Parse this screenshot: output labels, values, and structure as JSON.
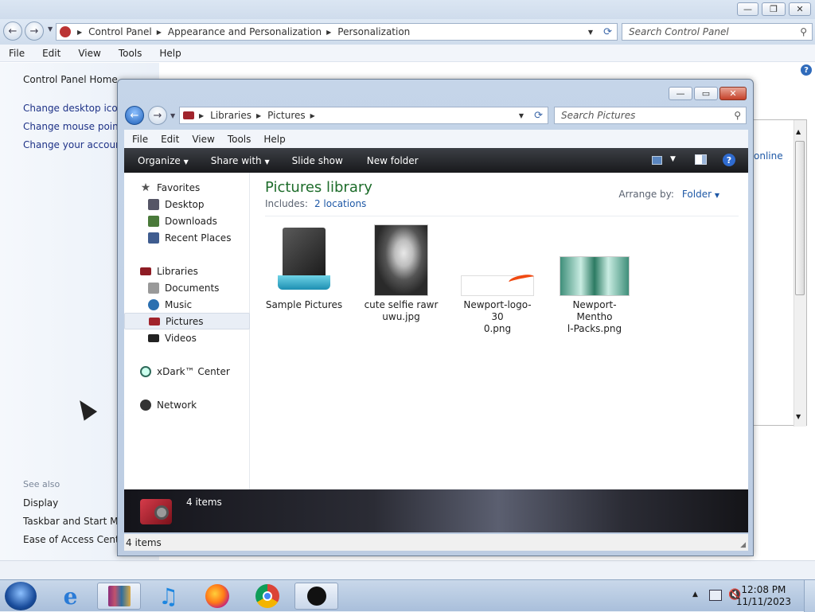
{
  "control_panel": {
    "breadcrumb": [
      "Control Panel",
      "Appearance and Personalization",
      "Personalization"
    ],
    "search_placeholder": "Search Control Panel",
    "menu": [
      "File",
      "Edit",
      "View",
      "Tools",
      "Help"
    ],
    "left_links": [
      "Control Panel Home",
      "Change desktop icons",
      "Change mouse pointe",
      "Change your account"
    ],
    "see_also_label": "See also",
    "see_also_links": [
      "Display",
      "Taskbar and Start Men",
      "Ease of Access Center"
    ],
    "partial_link": "online"
  },
  "explorer": {
    "breadcrumb": [
      "Libraries",
      "Pictures"
    ],
    "search_placeholder": "Search Pictures",
    "menu": [
      "File",
      "Edit",
      "View",
      "Tools",
      "Help"
    ],
    "toolbar": {
      "organize": "Organize",
      "share_with": "Share with",
      "slide_show": "Slide show",
      "new_folder": "New folder"
    },
    "nav": {
      "favorites": "Favorites",
      "desktop": "Desktop",
      "downloads": "Downloads",
      "recent_places": "Recent Places",
      "libraries": "Libraries",
      "documents": "Documents",
      "music": "Music",
      "pictures": "Pictures",
      "videos": "Videos",
      "xdark": "xDark™ Center",
      "network": "Network"
    },
    "library_title": "Pictures library",
    "includes_label": "Includes:",
    "includes_link": "2 locations",
    "arrange_label": "Arrange by:",
    "arrange_value": "Folder",
    "files": [
      {
        "line1": "Sample Pictures",
        "line2": ""
      },
      {
        "line1": "cute selfie rawr",
        "line2": "uwu.jpg"
      },
      {
        "line1": "Newport-logo-30",
        "line2": "0.png"
      },
      {
        "line1": "Newport-Mentho",
        "line2": "l-Packs.png"
      }
    ],
    "details_count": "4 items",
    "status_count": "4 items"
  },
  "taskbar": {
    "time": "12:08 PM",
    "date": "11/11/2023",
    "apps": [
      "start-orb",
      "internet-explorer",
      "winrar",
      "itunes",
      "firefox",
      "chrome",
      "xdark"
    ]
  },
  "colors": {
    "toolbar_dark": "#1e1f23",
    "library_title": "#1d6c2a",
    "link_blue": "#1e58a6"
  }
}
